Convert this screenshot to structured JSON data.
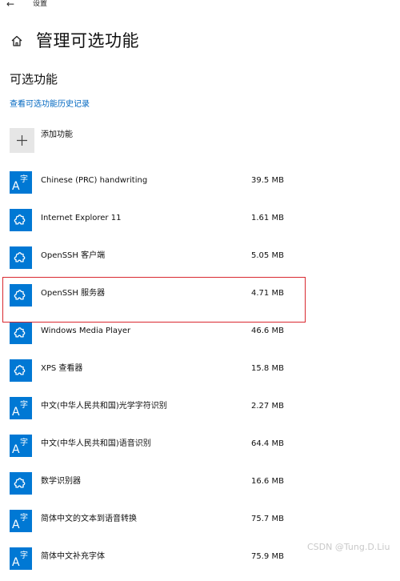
{
  "window": {
    "title": "设置",
    "back_icon": "arrow-left-icon"
  },
  "header": {
    "icon": "home-icon",
    "title": "管理可选功能"
  },
  "section": {
    "title": "可选功能",
    "history_link": "查看可选功能历史记录"
  },
  "add_feature": {
    "label": "添加功能",
    "icon": "plus-icon"
  },
  "accent_color": "#0078d4",
  "highlight_color": "#d9282f",
  "features": [
    {
      "name": "Chinese (PRC) handwriting",
      "size": "39.5 MB",
      "icon": "language-icon"
    },
    {
      "name": "Internet Explorer 11",
      "size": "1.61 MB",
      "icon": "puzzle-icon"
    },
    {
      "name": "OpenSSH 客户端",
      "size": "5.05 MB",
      "icon": "puzzle-icon"
    },
    {
      "name": "OpenSSH 服务器",
      "size": "4.71 MB",
      "icon": "puzzle-icon",
      "highlighted": true
    },
    {
      "name": "Windows Media Player",
      "size": "46.6 MB",
      "icon": "puzzle-icon"
    },
    {
      "name": "XPS 查看器",
      "size": "15.8 MB",
      "icon": "puzzle-icon"
    },
    {
      "name": "中文(中华人民共和国)光学字符识别",
      "size": "2.27 MB",
      "icon": "language-icon"
    },
    {
      "name": "中文(中华人民共和国)语音识别",
      "size": "64.4 MB",
      "icon": "language-icon"
    },
    {
      "name": "数学识别器",
      "size": "16.6 MB",
      "icon": "puzzle-icon"
    },
    {
      "name": "简体中文的文本到语音转换",
      "size": "75.7 MB",
      "icon": "language-icon"
    },
    {
      "name": "简体中文补充字体",
      "size": "75.9 MB",
      "icon": "language-icon"
    }
  ],
  "watermark": "CSDN @Tung.D.Liu"
}
